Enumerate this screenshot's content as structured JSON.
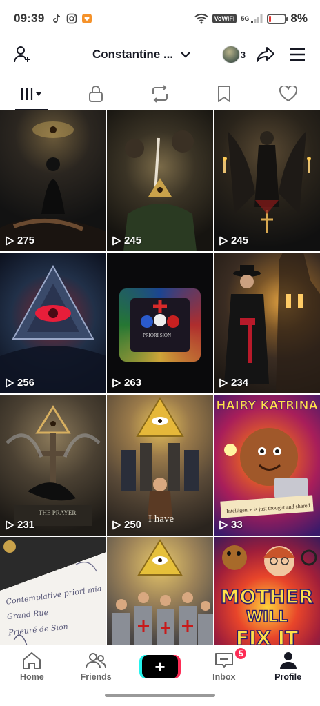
{
  "status_bar": {
    "time": "09:39",
    "network_badge": "VoWiFi",
    "signal_label": "5G",
    "battery_percent": "8%",
    "battery_level": 0.08,
    "app_icons": [
      "tiktok-icon",
      "instagram-icon",
      "orange-app-icon"
    ]
  },
  "header": {
    "profile_name": "Constantine ...",
    "follower_avatar_count": "3"
  },
  "tabs": [
    {
      "name": "videos",
      "icon": "grid-icon",
      "active": true
    },
    {
      "name": "private",
      "icon": "lock-icon",
      "active": false
    },
    {
      "name": "reposts",
      "icon": "repost-icon",
      "active": false
    },
    {
      "name": "favorites",
      "icon": "bookmark-icon",
      "active": false
    },
    {
      "name": "liked",
      "icon": "heart-icon",
      "active": false
    }
  ],
  "videos": [
    {
      "views": "275"
    },
    {
      "views": "245"
    },
    {
      "views": "245"
    },
    {
      "views": "256"
    },
    {
      "views": "263",
      "caption": "PRIORI SION"
    },
    {
      "views": "234"
    },
    {
      "views": "231",
      "caption": "THE PRAYER"
    },
    {
      "views": "250",
      "caption": "I have"
    },
    {
      "views": "33",
      "title": "HAIRY KATRINA",
      "caption": "Intelligence is just thought and shared."
    },
    {
      "views": "",
      "handwriting": [
        "Contemplative priori mia",
        "Grand Rue",
        "Prieuré de Sion"
      ]
    },
    {
      "views": ""
    },
    {
      "views": "",
      "title_line1": "MOTHER",
      "title_line2": "WILL",
      "title_line3": "FIX IT"
    }
  ],
  "bottom_nav": {
    "home": "Home",
    "friends": "Friends",
    "create": "+",
    "inbox": "Inbox",
    "inbox_badge": "5",
    "profile": "Profile"
  },
  "colors": {
    "accent_pink": "#fe2c55",
    "accent_cyan": "#25f4ee",
    "text_primary": "#161823"
  }
}
